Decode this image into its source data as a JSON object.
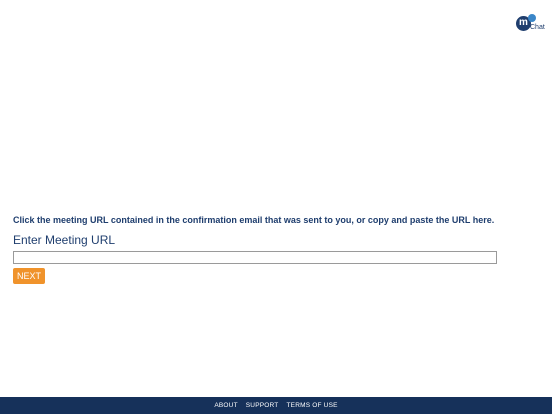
{
  "logo": {
    "letter": "m",
    "text": "Chat"
  },
  "main": {
    "instruction": "Click the meeting URL contained in the confirmation email that was sent to you, or copy and paste the URL here.",
    "field_label": "Enter Meeting URL",
    "url_value": "",
    "url_placeholder": "",
    "next_label": "NEXT"
  },
  "footer": {
    "links": [
      "ABOUT",
      "SUPPORT",
      "TERMS OF USE"
    ]
  },
  "colors": {
    "primary": "#1f3e6e",
    "accent": "#f0932b",
    "footer_bg": "#16315a"
  },
  "icons": {
    "logo": "mchat-logo-icon"
  }
}
